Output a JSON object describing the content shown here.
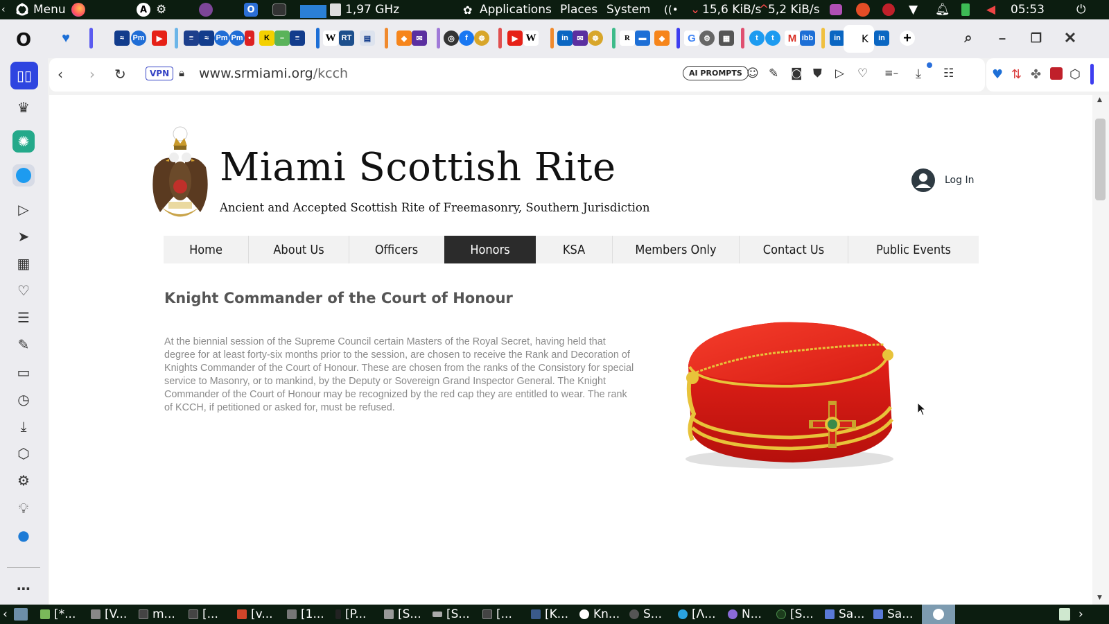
{
  "system_panel": {
    "menu_label": "Menu",
    "cpu_freq": "1,97 GHz",
    "menus": [
      "Applications",
      "Places",
      "System"
    ],
    "net_down": "15,6 KiB/s",
    "net_up": "5,2 KiB/s",
    "clock": "05:53"
  },
  "browser": {
    "vpn_badge": "VPN",
    "url_host": "www.srmiami.org",
    "url_path": "/kcch",
    "ai_prompts_label": "AI PROMPTS"
  },
  "site": {
    "title": "Miami Scottish Rite",
    "subtitle": "Ancient and Accepted Scottish Rite of Freemasonry, Southern Jurisdiction",
    "login_label": "Log In",
    "nav": [
      "Home",
      "About Us",
      "Officers",
      "Honors",
      "KSA",
      "Members Only",
      "Contact Us",
      "Public Events"
    ],
    "active_nav": "Honors",
    "accent_dark": "#2b2b2b",
    "hat_red": "#e31b17",
    "gold": "#e8c33a"
  },
  "content": {
    "heading": "Knight Commander of the Court of Honour",
    "body": "At the biennial session of the Supreme Council certain Masters of the Royal Secret, having held that degree for at least forty-six months prior to the session, are chosen to receive the Rank and Decoration of Knights Commander of the Court of Honour. These are chosen from the ranks of the Consistory for special service to Masonry, or to mankind, by the Deputy or Sovereign Grand Inspector General. The Knight Commander of the Court of Honour may be recognized by the red cap they are entitled to wear. The rank of KCCH, if petitioned or asked for, must be refused."
  },
  "taskbar": {
    "items": [
      "[*...",
      "[V...",
      "m...",
      "[...",
      "[v...",
      "[1...",
      "[P...",
      "[S...",
      "[S...",
      "[...",
      "[K...",
      "Kn...",
      "S...",
      "[Λ...",
      "N...",
      "[S...",
      "Sa...",
      "Sa..."
    ]
  }
}
